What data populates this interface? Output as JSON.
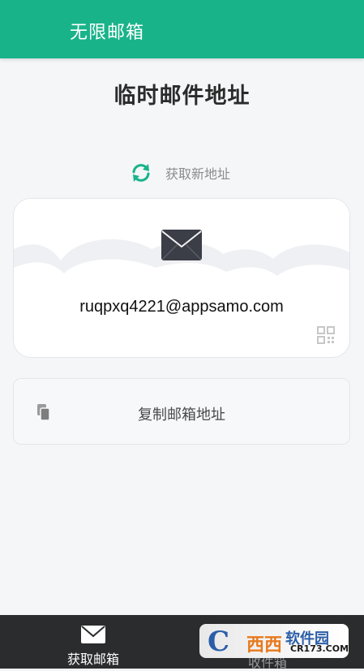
{
  "appbar": {
    "title": "无限邮箱"
  },
  "page": {
    "title": "临时邮件地址"
  },
  "refresh": {
    "label": "获取新地址",
    "icon": "refresh-icon"
  },
  "email_card": {
    "address": "ruqpxq4221@appsamo.com",
    "icon": "envelope-icon",
    "qr_icon": "qr-code-icon"
  },
  "copy_card": {
    "label": "复制邮箱地址",
    "icon": "copy-icon"
  },
  "bottom_nav": {
    "tabs": [
      {
        "label": "获取邮箱",
        "icon": "mail-icon",
        "active": true
      },
      {
        "label": "收件箱",
        "icon": "inbox-icon",
        "active": false
      }
    ]
  },
  "watermark": {
    "glyph": "C",
    "text": "西西",
    "brand": "软件园",
    "url": "CR173.COM"
  },
  "colors": {
    "primary": "#19b38a",
    "nav_bg": "#2b2c2e",
    "page_bg": "#f4f6f8"
  }
}
